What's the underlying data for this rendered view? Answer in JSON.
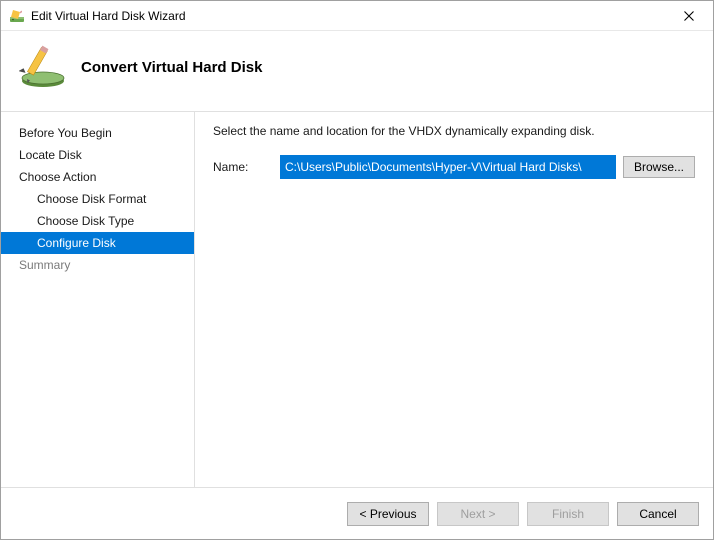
{
  "window": {
    "title": "Edit Virtual Hard Disk Wizard"
  },
  "header": {
    "page_title": "Convert Virtual Hard Disk"
  },
  "sidebar": {
    "items": [
      {
        "label": "Before You Begin",
        "indent": false,
        "selected": false,
        "dim": false
      },
      {
        "label": "Locate Disk",
        "indent": false,
        "selected": false,
        "dim": false
      },
      {
        "label": "Choose Action",
        "indent": false,
        "selected": false,
        "dim": false
      },
      {
        "label": "Choose Disk Format",
        "indent": true,
        "selected": false,
        "dim": false
      },
      {
        "label": "Choose Disk Type",
        "indent": true,
        "selected": false,
        "dim": false
      },
      {
        "label": "Configure Disk",
        "indent": true,
        "selected": true,
        "dim": false
      },
      {
        "label": "Summary",
        "indent": false,
        "selected": false,
        "dim": true
      }
    ]
  },
  "content": {
    "instruction": "Select the name and location for the VHDX dynamically expanding disk.",
    "name_label": "Name:",
    "name_value": "C:\\Users\\Public\\Documents\\Hyper-V\\Virtual Hard Disks\\",
    "browse_label": "Browse..."
  },
  "footer": {
    "previous": "< Previous",
    "next": "Next >",
    "finish": "Finish",
    "cancel": "Cancel",
    "next_enabled": false,
    "finish_enabled": false
  }
}
